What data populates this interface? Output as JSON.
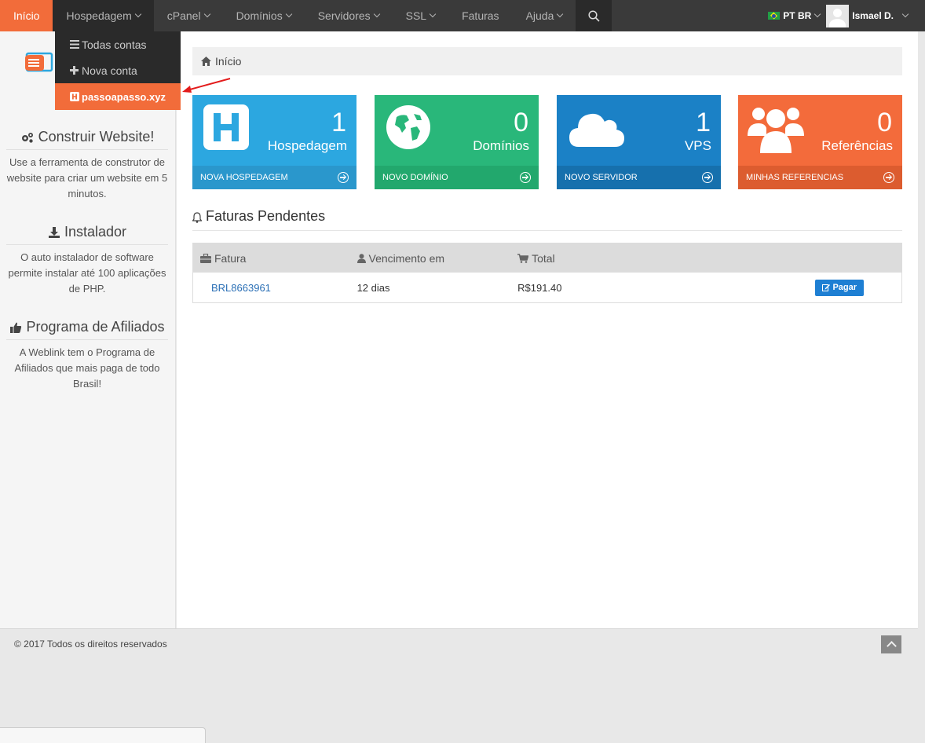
{
  "nav": {
    "items": [
      {
        "label": "Início",
        "caret": false
      },
      {
        "label": "Hospedagem",
        "caret": true
      },
      {
        "label": "cPanel",
        "caret": true
      },
      {
        "label": "Domínios",
        "caret": true
      },
      {
        "label": "Servidores",
        "caret": true
      },
      {
        "label": "SSL",
        "caret": true
      },
      {
        "label": "Faturas",
        "caret": false
      },
      {
        "label": "Ajuda",
        "caret": true
      }
    ],
    "language": "PT BR",
    "user": "Ismael D."
  },
  "dropdown": {
    "items": [
      {
        "label": "Todas contas",
        "icon": "list-icon"
      },
      {
        "label": "Nova conta",
        "icon": "plus-icon"
      },
      {
        "label": "passoapasso.xyz",
        "icon": "h-square-icon"
      }
    ]
  },
  "sidebar": {
    "blocks": [
      {
        "title": "Construir Website!",
        "icon": "gears-icon",
        "text": "Use a ferramenta de construtor de website para criar um website em 5 minutos."
      },
      {
        "title": "Instalador",
        "icon": "download-icon",
        "text": "O auto instalador de software permite instalar até 100 aplicações de PHP."
      },
      {
        "title": "Programa de Afiliados",
        "icon": "thumbs-up-icon",
        "text": "A Weblink tem o Programa de Afiliados que mais paga de todo Brasil!"
      }
    ]
  },
  "breadcrumb": {
    "label": "Início"
  },
  "tiles": [
    {
      "number": "1",
      "label": "Hospedagem",
      "footer": "NOVA HOSPEDAGEM",
      "color": "#2ca7e0",
      "footer_color": "#2a97cc",
      "icon": "hosting-icon"
    },
    {
      "number": "0",
      "label": "Domínios",
      "footer": "NOVO DOMÍNIO",
      "color": "#29b77a",
      "footer_color": "#22a86d",
      "icon": "globe-icon"
    },
    {
      "number": "1",
      "label": "VPS",
      "footer": "NOVO SERVIDOR",
      "color": "#1b81c6",
      "footer_color": "#1670ad",
      "icon": "cloud-icon"
    },
    {
      "number": "0",
      "label": "Referências",
      "footer": "MINHAS REFERENCIAS",
      "color": "#f36b3b",
      "footer_color": "#dc5c2f",
      "icon": "users-icon"
    }
  ],
  "invoices": {
    "title": "Faturas Pendentes",
    "headers": {
      "invoice": "Fatura",
      "due": "Vencimento em",
      "total": "Total"
    },
    "rows": [
      {
        "invoice": "BRL8663961",
        "due": "12 dias",
        "total": "R$191.40",
        "action": "Pagar"
      }
    ]
  },
  "footer": {
    "text": "© 2017 Todos os direitos reservados"
  }
}
